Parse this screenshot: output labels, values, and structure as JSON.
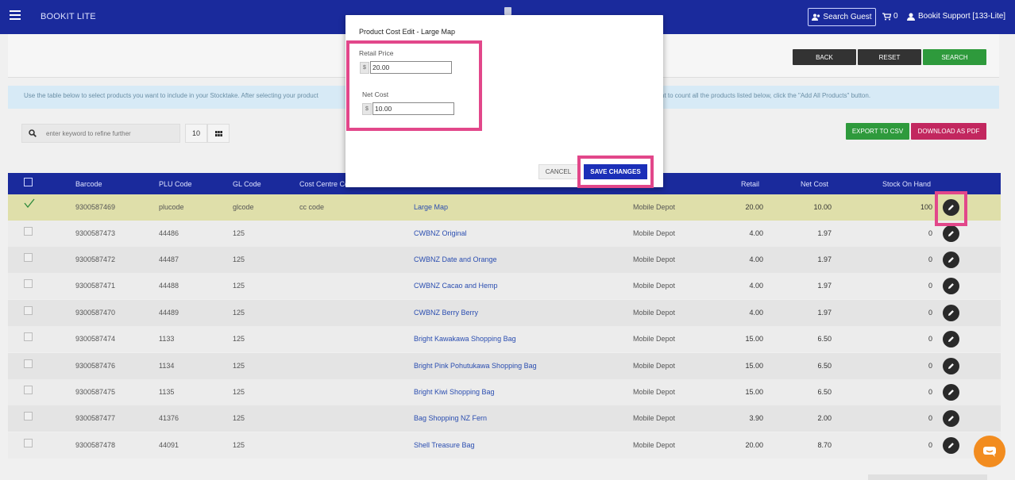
{
  "app": {
    "title": "BOOKIT LITE"
  },
  "header": {
    "search_guest": "Search Guest",
    "cart_count": "0",
    "user": "Bookit Support [133-Lite]"
  },
  "actions": {
    "back": "BACK",
    "reset": "RESET",
    "search": "SEARCH",
    "export_csv": "EXPORT TO CSV",
    "download_pdf": "DOWNLOAD AS PDF"
  },
  "info": {
    "text_left": "Use the table below to select products you want to include in your Stocktake. After selecting your product",
    "text_right": "nt to count all the products listed below, click the \"Add All Products\" button."
  },
  "search": {
    "placeholder": "enter keyword to refine further",
    "page_size": "10"
  },
  "table": {
    "headers": {
      "barcode": "Barcode",
      "plu": "PLU Code",
      "gl": "GL Code",
      "cost_centre": "Cost Centre Co",
      "retail": "Retail",
      "net_cost": "Net Cost",
      "stock": "Stock On Hand"
    },
    "rows": [
      {
        "barcode": "9300587469",
        "plu": "plucode",
        "gl": "glcode",
        "cc": "cc code",
        "name": "Large Map",
        "supplier": "Mobile Depot",
        "retail": "20.00",
        "net": "10.00",
        "stock": "100"
      },
      {
        "barcode": "9300587473",
        "plu": "44486",
        "gl": "125",
        "cc": "",
        "name": "CWBNZ Original",
        "supplier": "Mobile Depot",
        "retail": "4.00",
        "net": "1.97",
        "stock": "0"
      },
      {
        "barcode": "9300587472",
        "plu": "44487",
        "gl": "125",
        "cc": "",
        "name": "CWBNZ Date and Orange",
        "supplier": "Mobile Depot",
        "retail": "4.00",
        "net": "1.97",
        "stock": "0"
      },
      {
        "barcode": "9300587471",
        "plu": "44488",
        "gl": "125",
        "cc": "",
        "name": "CWBNZ Cacao and Hemp",
        "supplier": "Mobile Depot",
        "retail": "4.00",
        "net": "1.97",
        "stock": "0"
      },
      {
        "barcode": "9300587470",
        "plu": "44489",
        "gl": "125",
        "cc": "",
        "name": "CWBNZ Berry Berry",
        "supplier": "Mobile Depot",
        "retail": "4.00",
        "net": "1.97",
        "stock": "0"
      },
      {
        "barcode": "9300587474",
        "plu": "1133",
        "gl": "125",
        "cc": "",
        "name": "Bright Kawakawa Shopping Bag",
        "supplier": "Mobile Depot",
        "retail": "15.00",
        "net": "6.50",
        "stock": "0"
      },
      {
        "barcode": "9300587476",
        "plu": "1134",
        "gl": "125",
        "cc": "",
        "name": "Bright Pink Pohutukawa Shopping Bag",
        "supplier": "Mobile Depot",
        "retail": "15.00",
        "net": "6.50",
        "stock": "0"
      },
      {
        "barcode": "9300587475",
        "plu": "1135",
        "gl": "125",
        "cc": "",
        "name": "Bright Kiwi Shopping Bag",
        "supplier": "Mobile Depot",
        "retail": "15.00",
        "net": "6.50",
        "stock": "0"
      },
      {
        "barcode": "9300587477",
        "plu": "41376",
        "gl": "125",
        "cc": "",
        "name": "Bag Shopping NZ Fern",
        "supplier": "Mobile Depot",
        "retail": "3.90",
        "net": "2.00",
        "stock": "0"
      },
      {
        "barcode": "9300587478",
        "plu": "44091",
        "gl": "125",
        "cc": "",
        "name": "Shell Treasure Bag",
        "supplier": "Mobile Depot",
        "retail": "20.00",
        "net": "8.70",
        "stock": "0"
      }
    ]
  },
  "modal": {
    "title": "Product Cost Edit - Large Map",
    "retail_label": "Retail Price",
    "retail_value": "20.00",
    "net_label": "Net Cost",
    "net_value": "10.00",
    "currency": "$",
    "cancel": "CANCEL",
    "save": "SAVE CHANGES"
  },
  "colors": {
    "primary": "#1a2a9c",
    "success": "#2e9a3c",
    "danger": "#c2275f",
    "highlight": "#e2478a",
    "chat": "#f28c1f"
  }
}
